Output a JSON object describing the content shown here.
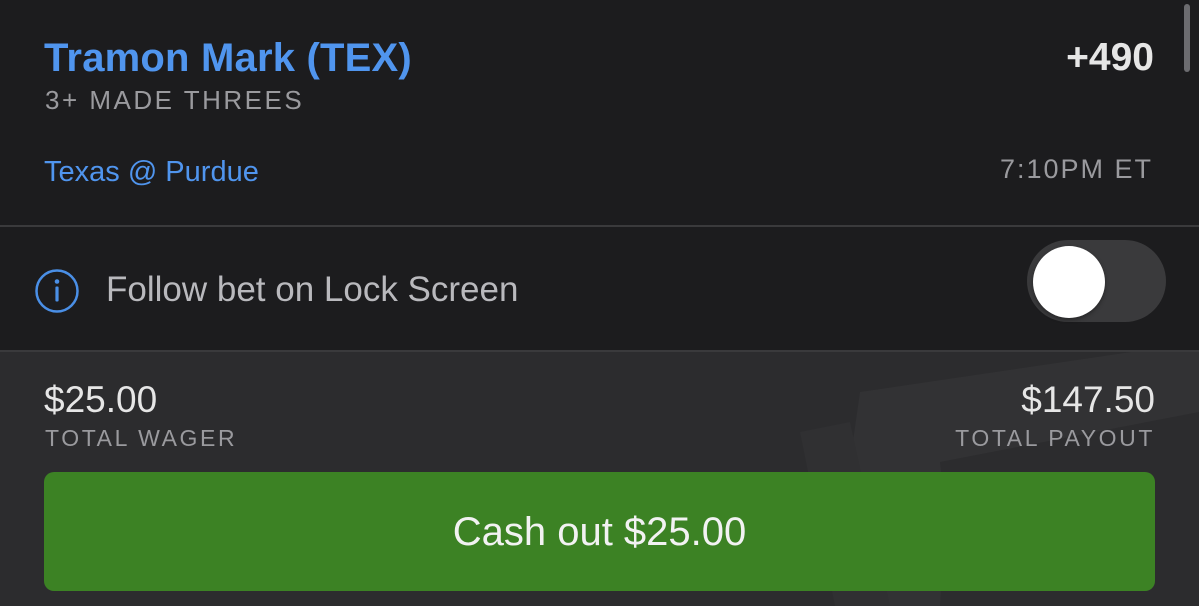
{
  "bet": {
    "player": "Tramon Mark (TEX)",
    "odds": "+490",
    "market": "3+ MADE THREES",
    "matchup": "Texas @ Purdue",
    "time": "7:10PM ET"
  },
  "follow": {
    "label": "Follow bet on Lock Screen",
    "icon": "info-icon",
    "toggle_on": false
  },
  "payout": {
    "wager_amount": "$25.00",
    "wager_label": "TOTAL WAGER",
    "payout_amount": "$147.50",
    "payout_label": "TOTAL PAYOUT"
  },
  "cashout": {
    "label": "Cash out $25.00"
  },
  "colors": {
    "background": "#1c1c1e",
    "panel": "#2c2c2e",
    "accent_blue": "#5095ee",
    "cashout_green": "#3c8224",
    "muted_text": "#9a9a9e"
  }
}
